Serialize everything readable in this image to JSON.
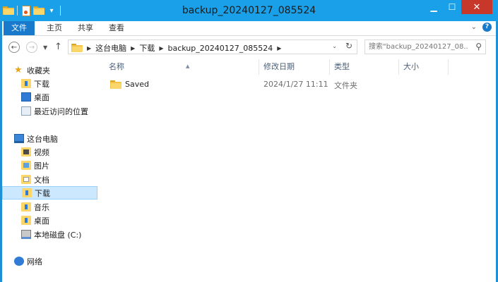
{
  "window": {
    "title": "backup_20240127_085524"
  },
  "ribbon_tabs": {
    "file": "文件",
    "home": "主页",
    "share": "共享",
    "view": "查看"
  },
  "address": {
    "segments": [
      "这台电脑",
      "下载",
      "backup_20240127_085524"
    ]
  },
  "search": {
    "placeholder": "搜索\"backup_20240127_08...\""
  },
  "nav_pane": {
    "favorites": "收藏夹",
    "fav_items": [
      "下载",
      "桌面",
      "最近访问的位置"
    ],
    "this_pc": "这台电脑",
    "pc_items": [
      "视频",
      "图片",
      "文档",
      "下载",
      "音乐",
      "桌面",
      "本地磁盘 (C:)"
    ],
    "network": "网络"
  },
  "columns": {
    "name": "名称",
    "modified": "修改日期",
    "type": "类型",
    "size": "大小"
  },
  "files": [
    {
      "name": "Saved",
      "modified": "2024/1/27 11:11",
      "type": "文件夹",
      "size": ""
    }
  ],
  "colors": {
    "titlebar": "#19a0e8",
    "file_tab": "#1979ca",
    "close": "#c7372a",
    "selection": "#cce8ff"
  }
}
